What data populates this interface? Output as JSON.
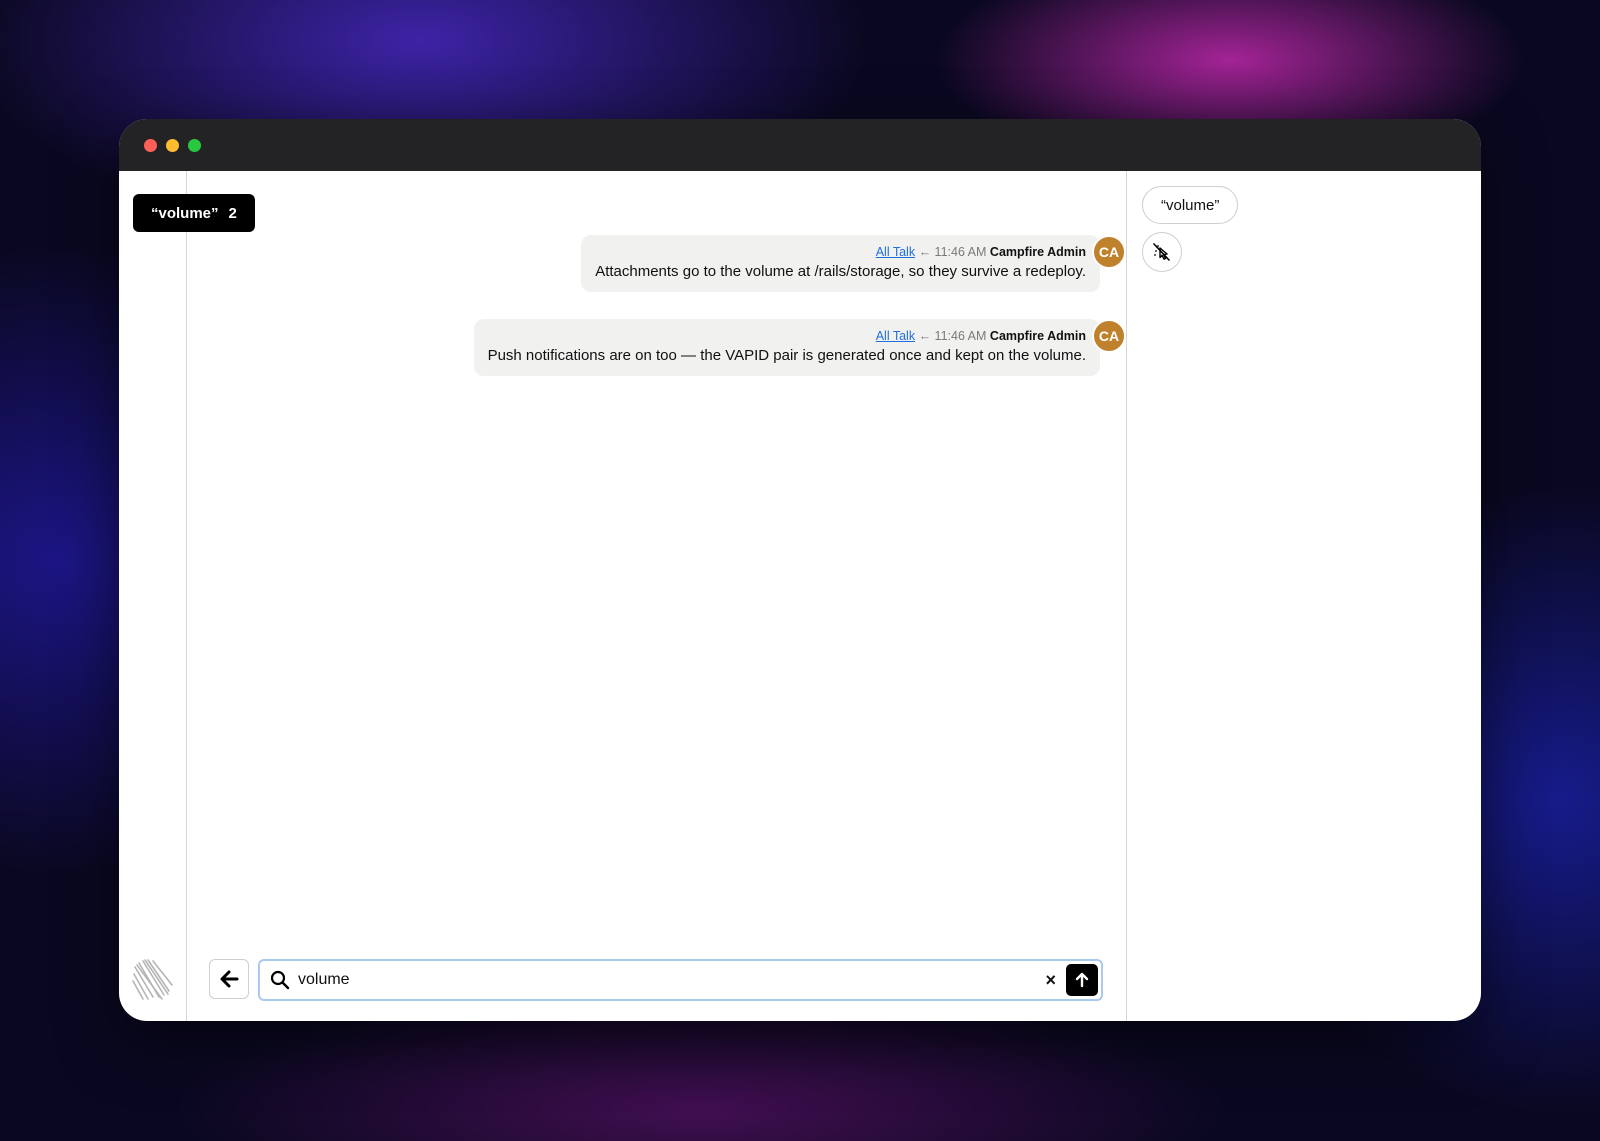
{
  "search": {
    "tag_label": "“volume”",
    "result_count": "2",
    "query": "volume",
    "clear_label": "×"
  },
  "messages": [
    {
      "room": "All Talk",
      "arrow": "←",
      "time": "11:46 AM",
      "author": "Campfire Admin",
      "initials": "CA",
      "text": "Attachments go to the volume at /rails/storage, so they survive a redeploy."
    },
    {
      "room": "All Talk",
      "arrow": "←",
      "time": "11:46 AM",
      "author": "Campfire Admin",
      "initials": "CA",
      "text": "Push notifications are on too — the VAPID pair is generated once and kept on the volume."
    }
  ],
  "sidebar": {
    "recent_search": "“volume”"
  },
  "colors": {
    "avatar": "#c0812c",
    "link": "#1f6fe0",
    "bubble": "#f1f1ef",
    "focus_ring": "#a9c9ee"
  },
  "icons": [
    "back-arrow-icon",
    "search-icon",
    "clear-icon",
    "submit-arrow-icon",
    "clear-history-icon",
    "campfire-logo"
  ]
}
